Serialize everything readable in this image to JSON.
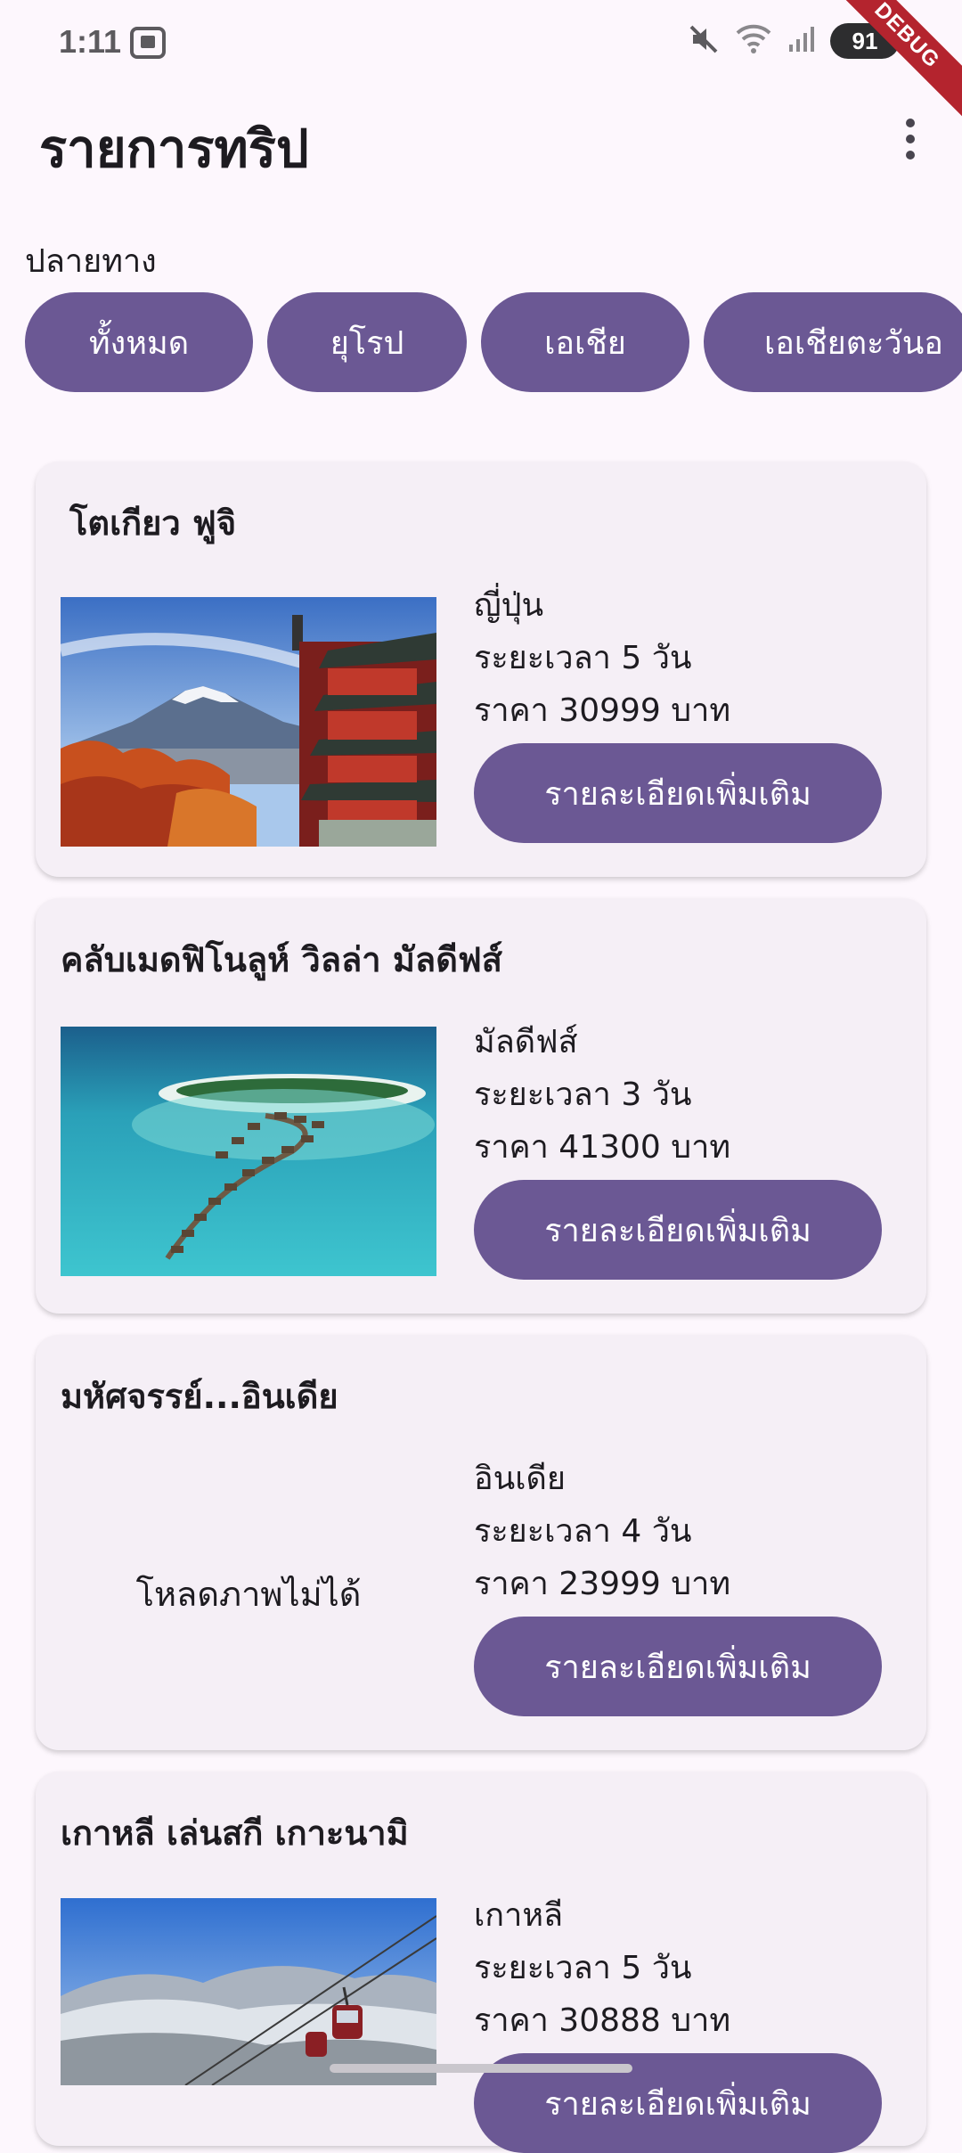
{
  "status_bar": {
    "time": "1:11",
    "battery": "91"
  },
  "debug_banner": "DEBUG",
  "app_bar": {
    "title": "รายการทริป"
  },
  "filter": {
    "label": "ปลายทาง",
    "chips": [
      "ทั้งหมด",
      "ยุโรป",
      "เอเชีย",
      "เอเชียตะวันอ"
    ]
  },
  "trips": [
    {
      "title": "โตเกียว ฟูจิ",
      "country": "ญี่ปุ่น",
      "duration": "ระยะเวลา 5 วัน",
      "price": "ราคา 30999 บาท",
      "button": "รายละเอียดเพิ่มเติม",
      "image": "mount-fuji-pagoda"
    },
    {
      "title": "คลับเมดฟิโนลูห์ วิลล่า มัลดีฟส์",
      "country": "มัลดีฟส์",
      "duration": "ระยะเวลา 3 วัน",
      "price": "ราคา 41300 บาท",
      "button": "รายละเอียดเพิ่มเติม",
      "image": "maldives-water-villas"
    },
    {
      "title": "มหัศจรรย์...อินเดีย",
      "country": "อินเดีย",
      "duration": "ระยะเวลา 4 วัน",
      "price": "ราคา 23999 บาท",
      "button": "รายละเอียดเพิ่มเติม",
      "image_error": "โหลดภาพไม่ได้"
    },
    {
      "title": "เกาหลี เล่นสกี เกาะนามิ",
      "country": "เกาหลี",
      "duration": "ระยะเวลา 5 วัน",
      "price": "ราคา 30888 บาท",
      "button": "รายละเอียดเพิ่มเติม",
      "image": "ski-resort-cable-car"
    }
  ],
  "colors": {
    "primary": "#6b5894",
    "background": "#fdf7fd",
    "card": "#f5eff6"
  }
}
